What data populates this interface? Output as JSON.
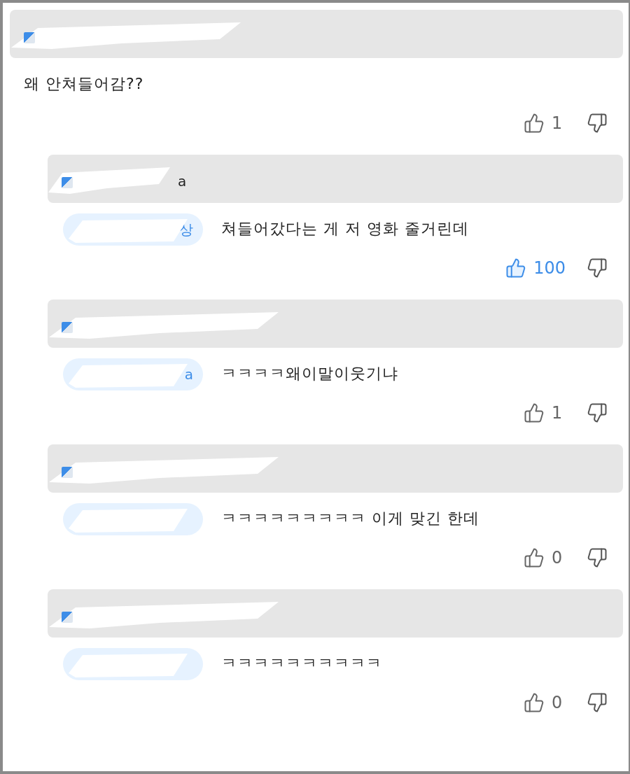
{
  "comment": {
    "text": "왜 안쳐들어감??",
    "likes": {
      "count": "1",
      "liked": false
    }
  },
  "replies": [
    {
      "header": {
        "name_tail": "a"
      },
      "mention": {
        "tail": "상"
      },
      "text": "쳐들어갔다는 게 저 영화 줄거린데",
      "likes": {
        "count": "100",
        "liked": true
      }
    },
    {
      "mention": {
        "tail": "a"
      },
      "text": "ㅋㅋㅋㅋ왜이말이웃기냐",
      "likes": {
        "count": "1",
        "liked": false
      }
    },
    {
      "text": "ㅋㅋㅋㅋㅋㅋㅋㅋㅋ 이게 맞긴 한데",
      "likes": {
        "count": "0",
        "liked": false
      }
    },
    {
      "text": "ㅋㅋㅋㅋㅋㅋㅋㅋㅋㅋ",
      "likes": {
        "count": "0",
        "liked": false
      }
    }
  ]
}
